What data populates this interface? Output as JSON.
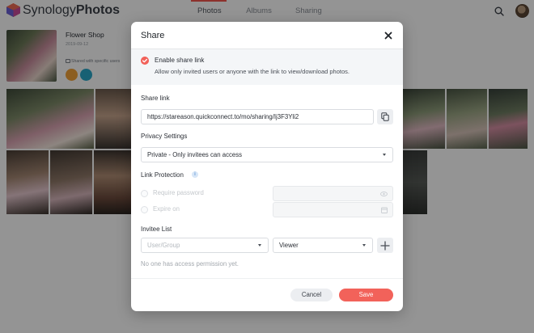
{
  "app": {
    "brand_part1": "Synology",
    "brand_part2": "Photos",
    "tabs": [
      {
        "label": "Photos",
        "active": true
      },
      {
        "label": "Albums",
        "active": false
      },
      {
        "label": "Sharing",
        "active": false
      }
    ],
    "search_icon": "search-icon",
    "accent_color": "#f2554c"
  },
  "album": {
    "title": "Flower Shop",
    "date": "2019-09-12",
    "shared_label": "Shared with specific users"
  },
  "dialog": {
    "title": "Share",
    "enable": {
      "label": "Enable share link",
      "description": "Allow only invited users or anyone with the link to view/download photos.",
      "checked": true
    },
    "share_link": {
      "label": "Share link",
      "value": "https://stareason.quickconnect.to/mo/sharing/Ij3F3Yli2",
      "copy_icon": "copy-icon"
    },
    "privacy": {
      "label": "Privacy Settings",
      "value": "Private - Only invitees can access"
    },
    "protection": {
      "label": "Link Protection",
      "info_icon_text": "i",
      "require_password": "Require password",
      "expire_on": "Expire on"
    },
    "invitees": {
      "label": "Invitee List",
      "user_placeholder": "User/Group",
      "role_value": "Viewer",
      "add_icon": "plus-icon",
      "empty_message": "No one has access permission yet."
    },
    "buttons": {
      "cancel": "Cancel",
      "save": "Save"
    },
    "primary_color": "#f2625a"
  }
}
